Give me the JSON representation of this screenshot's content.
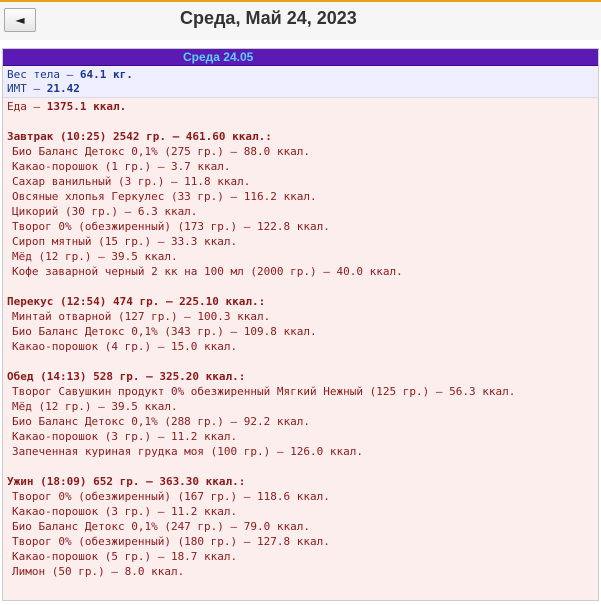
{
  "header": {
    "back_label": "◄",
    "title": "Среда, Май 24, 2023"
  },
  "day": {
    "label": "Среда 24.05"
  },
  "stats": {
    "weight_label": "Вес тела — ",
    "weight_value": "64.1 кг.",
    "bmi_label": "ИМТ — ",
    "bmi_value": "21.42"
  },
  "food_total": {
    "label": "Еда — ",
    "value": "1375.1 ккал."
  },
  "meals": [
    {
      "title": "Завтрак (10:25) 2542 гр. — 461.60 ккал.:",
      "items": [
        "Био Баланс Детокс 0,1% (275 гр.) — 88.0 ккал.",
        "Какао-порошок (1 гр.) — 3.7 ккал.",
        "Сахар ванильный (3 гр.) — 11.8 ккал.",
        "Овсяные хлопья Геркулес (33 гр.) — 116.2 ккал.",
        "Цикорий (30 гр.) — 6.3 ккал.",
        "Творог 0% (обезжиренный) (173 гр.) — 122.8 ккал.",
        "Сироп мятный (15 гр.) — 33.3 ккал.",
        "Мёд (12 гр.) — 39.5 ккал.",
        "Кофе заварной черный 2 кк на 100 мл (2000 гр.) — 40.0 ккал."
      ]
    },
    {
      "title": "Перекус (12:54) 474 гр. — 225.10 ккал.:",
      "items": [
        "Минтай отварной (127 гр.) — 100.3 ккал.",
        "Био Баланс Детокс 0,1% (343 гр.) — 109.8 ккал.",
        "Какао-порошок (4 гр.) — 15.0 ккал."
      ]
    },
    {
      "title": "Обед (14:13) 528 гр. — 325.20 ккал.:",
      "items": [
        "Творог Савушкин продукт 0% обезжиренный Мягкий Нежный (125 гр.) — 56.3 ккал.",
        "Мёд (12 гр.) — 39.5 ккал.",
        "Био Баланс Детокс 0,1% (288 гр.) — 92.2 ккал.",
        "Какао-порошок (3 гр.) — 11.2 ккал.",
        "Запеченная куриная грудка моя (100 гр.) — 126.0 ккал."
      ]
    },
    {
      "title": "Ужин (18:09) 652 гр. — 363.30 ккал.:",
      "items": [
        "Творог 0% (обезжиренный) (167 гр.) — 118.6 ккал.",
        "Какао-порошок (3 гр.) — 11.2 ккал.",
        "Био Баланс Детокс 0,1% (247 гр.) — 79.0 ккал.",
        "Творог 0% (обезжиренный) (180 гр.) — 127.8 ккал.",
        "Какао-порошок (5 гр.) — 18.7 ккал.",
        "Лимон (50 гр.) — 8.0 ккал."
      ]
    }
  ]
}
